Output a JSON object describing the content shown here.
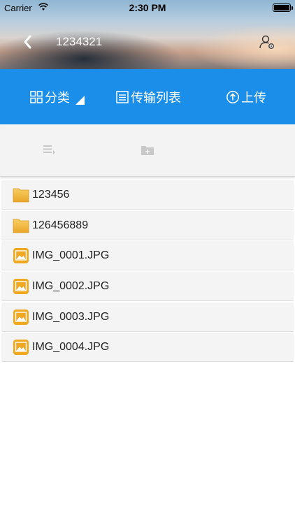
{
  "status_bar": {
    "carrier": "Carrier",
    "time": "2:30 PM"
  },
  "nav": {
    "title": "1234321",
    "back_icon": "chevron-left-icon",
    "user_icon": "user-settings-icon"
  },
  "tabs": [
    {
      "label": "分类",
      "icon": "grid-icon"
    },
    {
      "label": "传输列表",
      "icon": "list-box-icon"
    },
    {
      "label": "上传",
      "icon": "upload-circle-icon"
    }
  ],
  "toolbar": {
    "list_icon": "list-edit-icon",
    "folder_icon": "new-folder-icon"
  },
  "files": [
    {
      "name": "123456",
      "type": "folder"
    },
    {
      "name": "126456889",
      "type": "folder"
    },
    {
      "name": "IMG_0001.JPG",
      "type": "image"
    },
    {
      "name": "IMG_0002.JPG",
      "type": "image"
    },
    {
      "name": "IMG_0003.JPG",
      "type": "image"
    },
    {
      "name": "IMG_0004.JPG",
      "type": "image"
    }
  ],
  "colors": {
    "accent": "#1a8ee8",
    "folder": "#f2b33a",
    "image_icon": "#f0a81e"
  }
}
